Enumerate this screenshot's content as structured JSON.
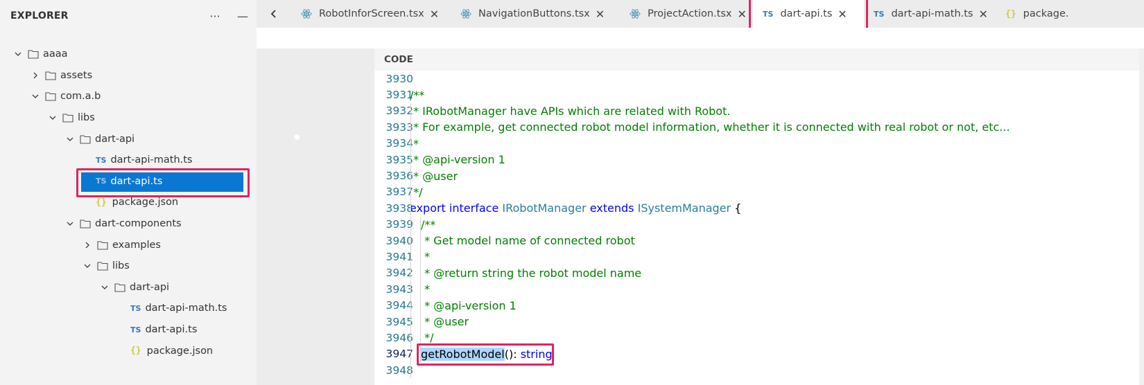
{
  "sidebar": {
    "title": "EXPLORER",
    "more_label": "···",
    "collapse_label": "—",
    "tree": [
      {
        "label": "aaaa",
        "kind": "folder",
        "depth": 0,
        "expanded": true
      },
      {
        "label": "assets",
        "kind": "folder",
        "depth": 1,
        "expanded": false
      },
      {
        "label": "com.a.b",
        "kind": "folder",
        "depth": 1,
        "expanded": true
      },
      {
        "label": "libs",
        "kind": "folder",
        "depth": 2,
        "expanded": true
      },
      {
        "label": "dart-api",
        "kind": "folder",
        "depth": 3,
        "expanded": true
      },
      {
        "label": "dart-api-math.ts",
        "kind": "ts",
        "depth": 4
      },
      {
        "label": "dart-api.ts",
        "kind": "ts",
        "depth": 4,
        "selected": true
      },
      {
        "label": "package.json",
        "kind": "json",
        "depth": 4
      },
      {
        "label": "dart-components",
        "kind": "folder",
        "depth": 3,
        "expanded": true
      },
      {
        "label": "examples",
        "kind": "folder",
        "depth": 4,
        "expanded": false
      },
      {
        "label": "libs",
        "kind": "folder",
        "depth": 4,
        "expanded": true
      },
      {
        "label": "dart-api",
        "kind": "folder",
        "depth": 5,
        "expanded": true
      },
      {
        "label": "dart-api-math.ts",
        "kind": "ts",
        "depth": 6
      },
      {
        "label": "dart-api.ts",
        "kind": "ts",
        "depth": 6
      },
      {
        "label": "package.json",
        "kind": "json",
        "depth": 6
      }
    ]
  },
  "icons": {
    "ts": "TS",
    "json": "{}"
  },
  "tabs": [
    {
      "label": "RobotInforScreen.tsx",
      "icon": "react-icon",
      "close": "✕"
    },
    {
      "label": "NavigationButtons.tsx",
      "icon": "react-icon",
      "close": "✕"
    },
    {
      "label": "ProjectAction.tsx",
      "icon": "react-icon",
      "close": "✕"
    },
    {
      "label": "dart-api.ts",
      "icon": "ts-icon",
      "close": "✕",
      "active": true
    },
    {
      "label": "dart-api-math.ts",
      "icon": "ts-icon",
      "close": "✕"
    },
    {
      "label": "package.",
      "icon": "json-icon"
    }
  ],
  "code": {
    "header": "CODE",
    "lines": [
      {
        "n": "3930",
        "parts": []
      },
      {
        "n": "3931",
        "parts": [
          {
            "t": "/**",
            "c": "cm"
          }
        ]
      },
      {
        "n": "3932",
        "parts": [
          {
            "t": " * IRobotManager have APIs which are related with Robot.",
            "c": "cm"
          }
        ]
      },
      {
        "n": "3933",
        "parts": [
          {
            "t": " * For example, get connected robot model information, whether it is connected with real robot or not, etc...",
            "c": "cm"
          }
        ]
      },
      {
        "n": "3934",
        "parts": [
          {
            "t": " *",
            "c": "cm"
          }
        ]
      },
      {
        "n": "3935",
        "parts": [
          {
            "t": " * @api-version 1",
            "c": "cm"
          }
        ]
      },
      {
        "n": "3936",
        "parts": [
          {
            "t": " * @user",
            "c": "cm"
          }
        ]
      },
      {
        "n": "3937",
        "parts": [
          {
            "t": " */",
            "c": "cm"
          }
        ]
      },
      {
        "n": "3938",
        "parts": [
          {
            "t": "export",
            "c": "kw"
          },
          {
            "t": " ",
            "c": "pl"
          },
          {
            "t": "interface",
            "c": "kw"
          },
          {
            "t": " ",
            "c": "pl"
          },
          {
            "t": "IRobotManager",
            "c": "ty"
          },
          {
            "t": " ",
            "c": "pl"
          },
          {
            "t": "extends",
            "c": "kw"
          },
          {
            "t": " ",
            "c": "pl"
          },
          {
            "t": "ISystemManager",
            "c": "ty"
          },
          {
            "t": " {",
            "c": "pl"
          }
        ]
      },
      {
        "n": "3939",
        "indent": 1,
        "parts": [
          {
            "t": "/**",
            "c": "cm"
          }
        ]
      },
      {
        "n": "3940",
        "indent": 1,
        "parts": [
          {
            "t": " * Get model name of connected robot",
            "c": "cm"
          }
        ]
      },
      {
        "n": "3941",
        "indent": 1,
        "parts": [
          {
            "t": " *",
            "c": "cm"
          }
        ]
      },
      {
        "n": "3942",
        "indent": 1,
        "parts": [
          {
            "t": " * @return string the robot model name",
            "c": "cm"
          }
        ]
      },
      {
        "n": "3943",
        "indent": 1,
        "parts": [
          {
            "t": " *",
            "c": "cm"
          }
        ]
      },
      {
        "n": "3944",
        "indent": 1,
        "parts": [
          {
            "t": " * @api-version 1",
            "c": "cm"
          }
        ]
      },
      {
        "n": "3945",
        "indent": 1,
        "parts": [
          {
            "t": " * @user",
            "c": "cm"
          }
        ]
      },
      {
        "n": "3946",
        "indent": 1,
        "parts": [
          {
            "t": " */",
            "c": "cm"
          }
        ]
      },
      {
        "n": "3947",
        "indent": 1,
        "active": true,
        "parts": [
          {
            "t": "getRobotModel",
            "c": "pl hl"
          },
          {
            "t": "(): ",
            "c": "pl"
          },
          {
            "t": "string",
            "c": "kw"
          }
        ]
      },
      {
        "n": "3948",
        "parts": []
      }
    ]
  }
}
